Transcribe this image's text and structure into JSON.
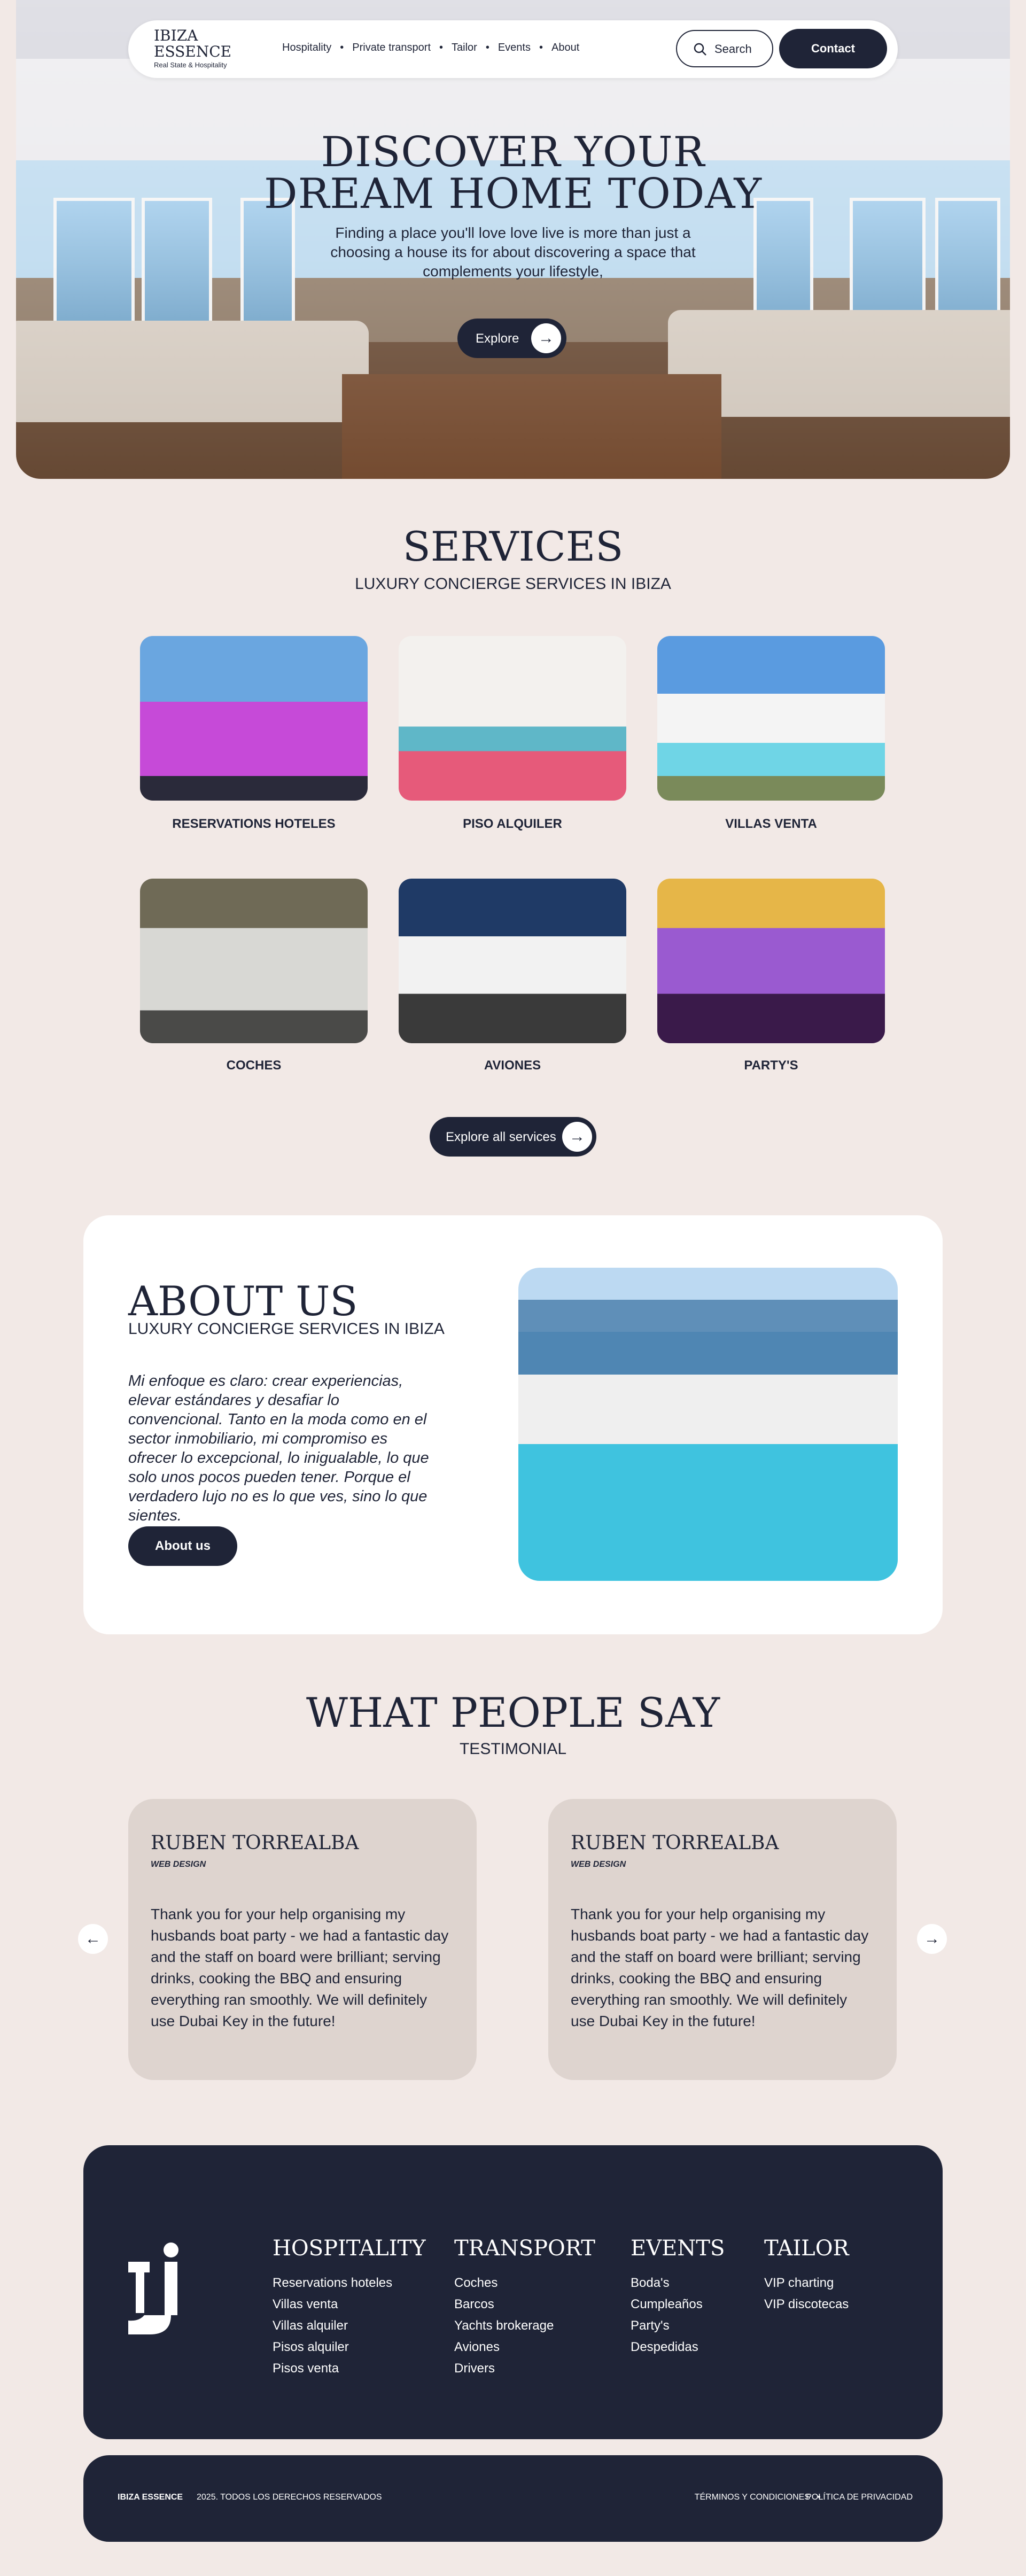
{
  "nav": {
    "logo_line1": "IBIZA",
    "logo_line2": "ESSENCE",
    "logo_tagline": "Real State & Hospitality",
    "links": [
      "Hospitality",
      "Private transport",
      "Tailor",
      "Events",
      "About"
    ],
    "search_label": "Search",
    "contact_label": "Contact"
  },
  "hero": {
    "title_line1": "DISCOVER YOUR",
    "title_line2": "DREAM HOME TODAY",
    "subtitle": "Finding a place you'll love love live is more than just a choosing a house its for about discovering a space that complements your lifestyle,",
    "cta_label": "Explore"
  },
  "services": {
    "title": "SERVICES",
    "subtitle": "LUXURY CONCIERGE SERVICES IN IBIZA",
    "items": [
      {
        "label": "RESERVATIONS HOTELES"
      },
      {
        "label": "PISO ALQUILER"
      },
      {
        "label": "VILLAS VENTA"
      },
      {
        "label": "COCHES"
      },
      {
        "label": "AVIONES"
      },
      {
        "label": "PARTY'S"
      }
    ],
    "all_label": "Explore all services"
  },
  "about": {
    "title": "ABOUT US",
    "subtitle": "LUXURY CONCIERGE SERVICES IN IBIZA",
    "text": "Mi enfoque es claro: crear experiencias, elevar estándares y desafiar lo convencional. Tanto en la moda como en el sector inmobiliario, mi compromiso es ofrecer lo excepcional, lo inigualable, lo que solo unos pocos pueden tener. Porque el verdadero lujo no es lo que ves, sino lo que sientes.",
    "button_label": "About us"
  },
  "testimonials": {
    "title": "WHAT PEOPLE SAY",
    "subtitle": "TESTIMONIAL",
    "items": [
      {
        "name": "RUBEN TORREALBA",
        "role": "WEB DESIGN",
        "text": "Thank you for your help organising my husbands boat party - we had a fantastic day and the staff on board were brilliant; serving drinks, cooking the BBQ and ensuring everything ran smoothly. We will definitely use Dubai Key in the future!"
      },
      {
        "name": "RUBEN TORREALBA",
        "role": "WEB DESIGN",
        "text": "Thank you for your help organising my husbands boat party - we had a fantastic day and the staff on board were brilliant; serving drinks, cooking the BBQ and ensuring everything ran smoothly. We will definitely use Dubai Key in the future!"
      }
    ]
  },
  "footer": {
    "columns": [
      {
        "heading": "HOSPITALITY",
        "items": [
          "Reservations hoteles",
          "Villas venta",
          "Villas alquiler",
          "Pisos alquiler",
          "Pisos venta"
        ]
      },
      {
        "heading": "TRANSPORT",
        "items": [
          "Coches",
          "Barcos",
          "Yachts brokerage",
          "Aviones",
          "Drivers"
        ]
      },
      {
        "heading": "EVENTS",
        "items": [
          "Boda's",
          "Cumpleaños",
          "Party's",
          "Despedidas"
        ]
      },
      {
        "heading": "TAILOR",
        "items": [
          "VIP charting",
          "VIP discotecas"
        ]
      }
    ],
    "brand": "IBIZA ESSENCE",
    "copyright": "2025. TODOS LOS DERECHOS RESERVADOS",
    "terms": "TÉRMINOS Y CONDICIONES",
    "privacy": "POLÍTICA DE PRIVACIDAD"
  }
}
